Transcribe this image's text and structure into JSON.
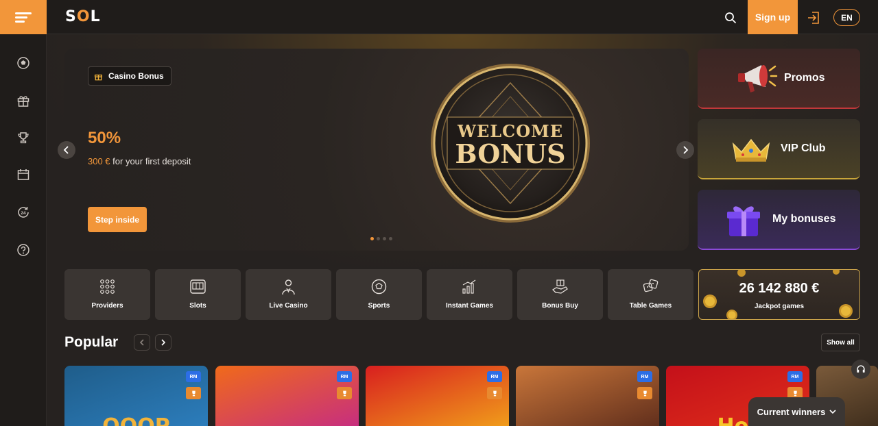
{
  "header": {
    "logo": "SOL",
    "signup_label": "Sign up",
    "lang_label": "EN"
  },
  "rail": {
    "items": [
      "sports-icon",
      "gift-icon",
      "trophy-icon",
      "calendar-icon",
      "support-24-icon",
      "help-icon"
    ]
  },
  "hero": {
    "badge_label": "Casino Bonus",
    "percent": "50%",
    "amount": "300 €",
    "subtitle": "for your first deposit",
    "cta_label": "Step inside",
    "coin_line1": "WELCOME",
    "coin_line2": "BONUS",
    "slide_count": 4,
    "active_slide": 1
  },
  "promos": [
    {
      "label": "Promos",
      "icon": "megaphone-icon"
    },
    {
      "label": "VIP Club",
      "icon": "crown-icon"
    },
    {
      "label": "My bonuses",
      "icon": "gift-box-icon"
    }
  ],
  "categories": [
    {
      "label": "Providers",
      "icon": "grid-dots-icon"
    },
    {
      "label": "Slots",
      "icon": "slot-machine-icon"
    },
    {
      "label": "Live Casino",
      "icon": "dealer-icon"
    },
    {
      "label": "Sports",
      "icon": "soccer-ball-icon"
    },
    {
      "label": "Instant Games",
      "icon": "chart-bars-icon"
    },
    {
      "label": "Bonus Buy",
      "icon": "hand-gift-icon"
    },
    {
      "label": "Table Games",
      "icon": "dice-icon"
    }
  ],
  "jackpot": {
    "value": "26 142 880 €",
    "label": "Jackpot games"
  },
  "popular": {
    "title": "Popular",
    "show_all_label": "Show all",
    "games": [
      {
        "badge": "RM",
        "title": "OOOP",
        "colors": [
          "#1f5d8a",
          "#2d7fbf"
        ],
        "title_color": "#f2b33a"
      },
      {
        "badge": "RM",
        "title": "",
        "colors": [
          "#f06a1a",
          "#c42a86"
        ],
        "title_color": "#fff"
      },
      {
        "badge": "RM",
        "title": "",
        "colors": [
          "#d81f1f",
          "#f2a51a"
        ],
        "title_color": "#fff"
      },
      {
        "badge": "RM",
        "title": "",
        "colors": [
          "#c9763a",
          "#5a2a1a"
        ],
        "title_color": "#fff"
      },
      {
        "badge": "RM",
        "title": "Hot",
        "colors": [
          "#c4101a",
          "#e0301a"
        ],
        "title_color": "#f7c52a"
      },
      {
        "badge": "",
        "title": "",
        "colors": [
          "#7a5a3a",
          "#3a2a1a"
        ],
        "title_color": "#fff"
      }
    ]
  },
  "widgets": {
    "winners_label": "Current winners"
  },
  "colors": {
    "accent": "#f2963a",
    "background": "#262220",
    "header": "#1f1c1a",
    "tile": "#3a3532"
  }
}
